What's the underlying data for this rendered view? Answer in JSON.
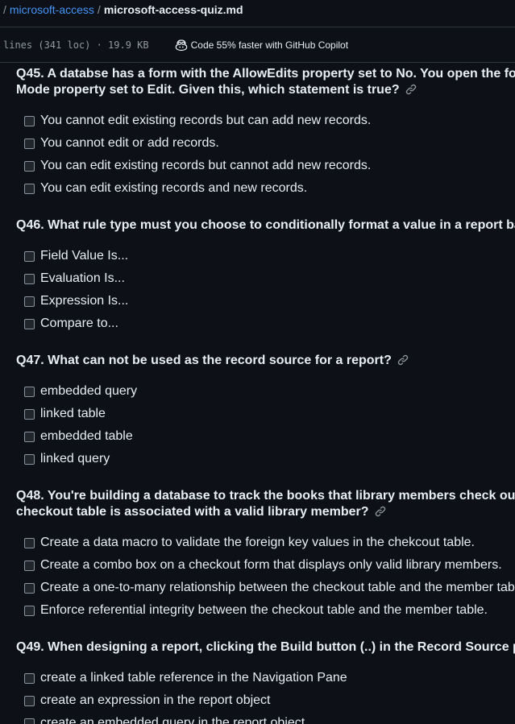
{
  "breadcrumb": {
    "sep1": "/",
    "folder": "microsoft-access",
    "sep2": "/",
    "file": "microsoft-access-quiz.md"
  },
  "file_info": {
    "meta": "lines (341 loc) · 19.9 KB",
    "copilot": "Code 55% faster with GitHub Copilot"
  },
  "questions": [
    {
      "line1": "Q45. A databse has a form with the AllowEdits property set to No. You open the fo",
      "line2": "Mode property set to Edit. Given this, which statement is true?",
      "options": [
        "You cannot edit existing records but can add new records.",
        "You cannot edit or add records.",
        "You can edit existing records but cannot add new records.",
        "You can edit existing records and new records."
      ]
    },
    {
      "line1": "Q46. What rule type must you choose to conditionally format a value in a report ba",
      "options": [
        "Field Value Is...",
        "Evaluation Is...",
        "Expression Is...",
        "Compare to..."
      ]
    },
    {
      "line1": "Q47. What can not be used as the record source for a report?",
      "options": [
        "embedded query",
        "linked table",
        "embedded table",
        "linked query"
      ]
    },
    {
      "line1": "Q48. You're building a database to track the books that library members check ou",
      "line2": "checkout table is associated with a valid library member?",
      "options": [
        "Create a data macro to validate the foreign key values in the chekcout table.",
        "Create a combo box on a checkout form that displays only valid library members.",
        "Create a one-to-many relationship between the checkout table and the member tab",
        "Enforce referential integrity between the checkout table and the member table."
      ]
    },
    {
      "line1": "Q49. When designing a report, clicking the Build button (..) in the Record Source p",
      "options": [
        "create a linked table reference in the Navigation Pane",
        "create an expression in the report object",
        "create an embedded query in the report object"
      ]
    }
  ]
}
